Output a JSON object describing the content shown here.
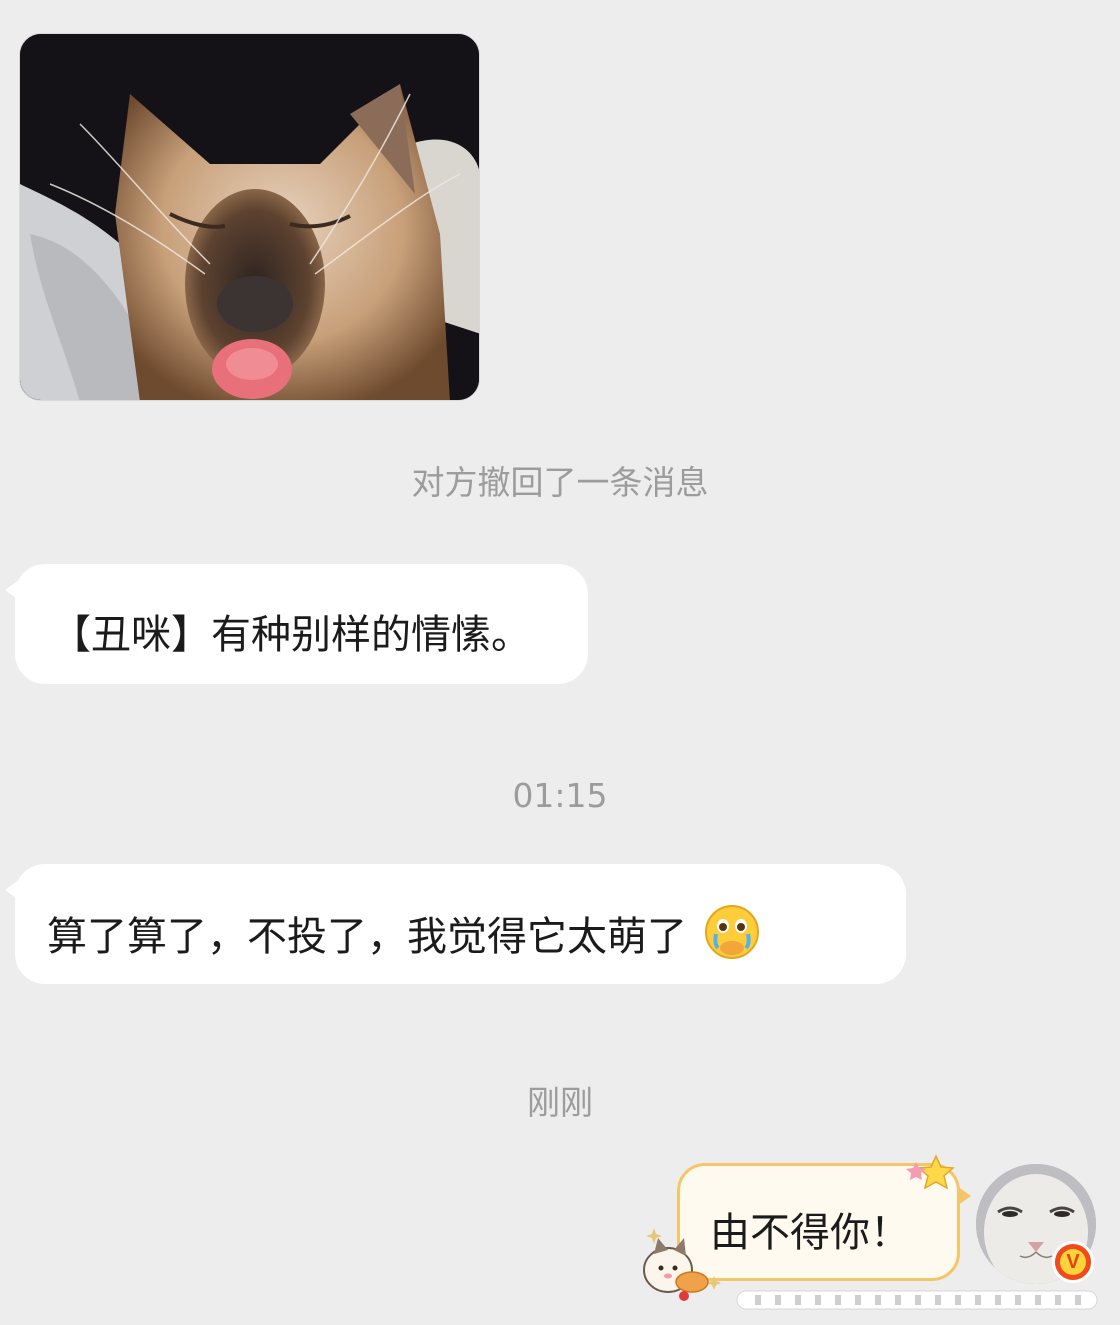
{
  "messages": {
    "recall_notice": "对方撤回了一条消息",
    "bubble_1": "【丑咪】有种别样的情愫。",
    "timestamp_1": "01:15",
    "bubble_2": "算了算了，不投了，我觉得它太萌了",
    "bubble_2_emoji": "crying-face-emoji",
    "timestamp_2": "刚刚",
    "self_bubble": "由不得你！"
  },
  "icons": {
    "photo": "cat-photo",
    "avatar": "cat-avatar",
    "badge": "vip-badge-icon",
    "badge_text": "V"
  },
  "colors": {
    "background": "#ededed",
    "bubble": "#ffffff",
    "self_bubble_border": "#f3c66a",
    "system_text": "#9c9c9c",
    "badge": "#f24a1c"
  }
}
